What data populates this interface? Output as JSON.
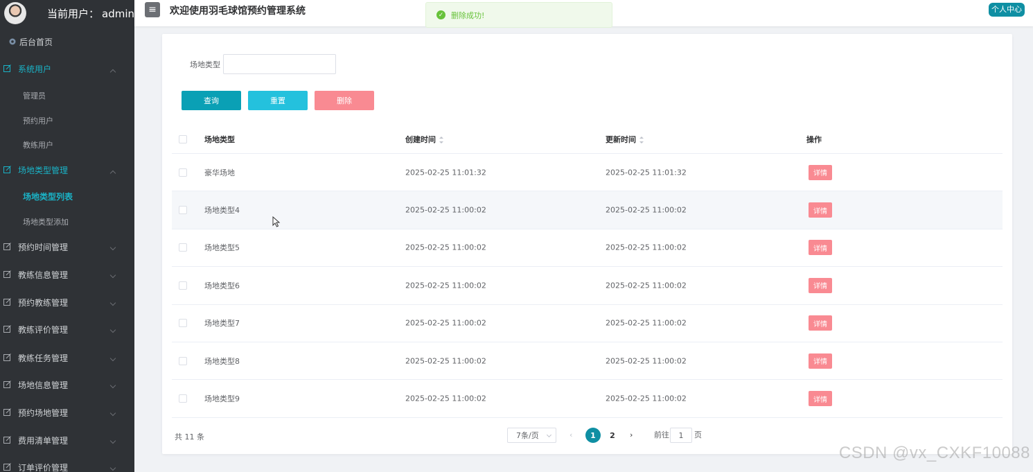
{
  "sidebar": {
    "user_label": "当前用户：",
    "username": "admin",
    "home": "后台首页",
    "groups": [
      {
        "label": "系统用户",
        "expanded": true,
        "items": [
          "管理员",
          "预约用户",
          "教练用户"
        ]
      },
      {
        "label": "场地类型管理",
        "expanded": true,
        "items": [
          "场地类型列表",
          "场地类型添加"
        ]
      },
      {
        "label": "预约时间管理"
      },
      {
        "label": "教练信息管理"
      },
      {
        "label": "预约教练管理"
      },
      {
        "label": "教练评价管理"
      },
      {
        "label": "教练任务管理"
      },
      {
        "label": "场地信息管理"
      },
      {
        "label": "预约场地管理"
      },
      {
        "label": "费用清单管理"
      },
      {
        "label": "订单评价管理"
      }
    ]
  },
  "header": {
    "title": "欢迎使用羽毛球馆预约管理系统",
    "profile": "个人中心",
    "toast": "删除成功!"
  },
  "filter": {
    "label": "场地类型",
    "value": ""
  },
  "buttons": {
    "query": "查询",
    "reset": "重置",
    "delete": "删除"
  },
  "table": {
    "headers": [
      "场地类型",
      "创建时间",
      "更新时间",
      "操作"
    ],
    "detail_label": "详情",
    "rows": [
      {
        "type": "豪华场地",
        "created": "2025-02-25 11:01:32",
        "updated": "2025-02-25 11:01:32"
      },
      {
        "type": "场地类型4",
        "created": "2025-02-25 11:00:02",
        "updated": "2025-02-25 11:00:02"
      },
      {
        "type": "场地类型5",
        "created": "2025-02-25 11:00:02",
        "updated": "2025-02-25 11:00:02"
      },
      {
        "type": "场地类型6",
        "created": "2025-02-25 11:00:02",
        "updated": "2025-02-25 11:00:02"
      },
      {
        "type": "场地类型7",
        "created": "2025-02-25 11:00:02",
        "updated": "2025-02-25 11:00:02"
      },
      {
        "type": "场地类型8",
        "created": "2025-02-25 11:00:02",
        "updated": "2025-02-25 11:00:02"
      },
      {
        "type": "场地类型9",
        "created": "2025-02-25 11:00:02",
        "updated": "2025-02-25 11:00:02"
      }
    ]
  },
  "pagination": {
    "total": "共 11 条",
    "page_size": "7条/页",
    "pages": [
      "1",
      "2"
    ],
    "current": "1",
    "goto_prefix": "前往",
    "goto_value": "1",
    "goto_suffix": "页"
  },
  "watermark": "CSDN @vx_CXKF10088",
  "colors": {
    "primary": "#0f8fa3",
    "query_btn": "#0aa0b5",
    "reset_btn": "#24c1dd",
    "danger": "#f98a92",
    "sidebar_bg": "#2f3236",
    "sidebar_active": "#1ab3c7"
  }
}
